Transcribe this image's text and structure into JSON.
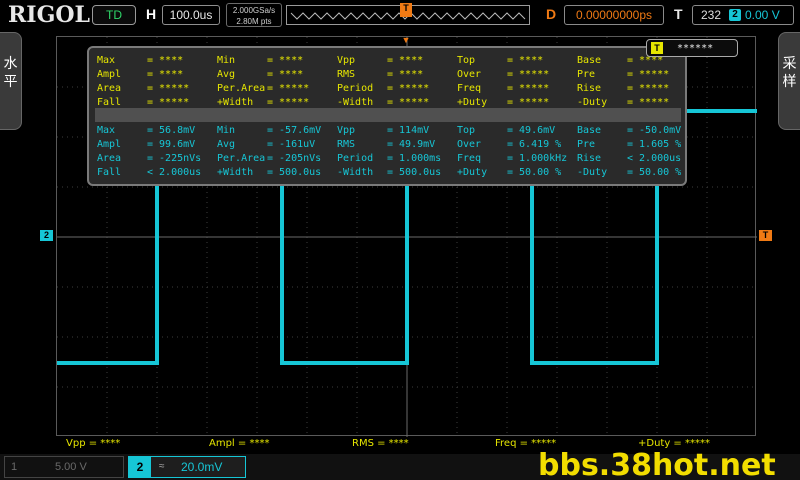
{
  "brand": "RIGOL",
  "topbar": {
    "mode": "TD",
    "h_label": "H",
    "timebase": "100.0us",
    "sample_rate": "2.000GSa/s",
    "memory_depth": "2.80M pts",
    "d_label": "D",
    "delay": "0.00000000ps",
    "t_label": "T",
    "trigger_count": "232",
    "trigger_source": "2",
    "trigger_level": "0.00 V"
  },
  "side": {
    "left_label": "水\n平",
    "right_label": "采\n样"
  },
  "markers": {
    "ch2": "2",
    "trigger_level": "T",
    "trigger_position": "T"
  },
  "measure": {
    "stats_label": "T",
    "stats_value": "******",
    "rows": [
      [
        "Max",
        "= ****",
        "Min",
        "= ****",
        "Vpp",
        "= ****",
        "Top",
        "= ****",
        "Base",
        "= ****"
      ],
      [
        "Ampl",
        "= ****",
        "Avg",
        "= ****",
        "RMS",
        "= ****",
        "Over",
        "= *****",
        "Pre",
        "= *****"
      ],
      [
        "Area",
        "= *****",
        "Per.Area",
        "= *****",
        "Period",
        "= *****",
        "Freq",
        "= *****",
        "Rise",
        "= *****"
      ],
      [
        "Fall",
        "= *****",
        "+Width",
        "= *****",
        "-Width",
        "= *****",
        "+Duty",
        "= *****",
        "-Duty",
        "= *****"
      ],
      [
        "Max",
        "= 56.8mV",
        "Min",
        "= -57.6mV",
        "Vpp",
        "= 114mV",
        "Top",
        "= 49.6mV",
        "Base",
        "= -50.0mV"
      ],
      [
        "Ampl",
        "= 99.6mV",
        "Avg",
        "= -161uV",
        "RMS",
        "= 49.9mV",
        "Over",
        "= 6.419 %",
        "Pre",
        "= 1.605 %"
      ],
      [
        "Area",
        "= -225nVs",
        "Per.Area",
        "= -205nVs",
        "Period",
        "= 1.000ms",
        "Freq",
        "= 1.000kHz",
        "Rise",
        "< 2.000us"
      ],
      [
        "Fall",
        "< 2.000us",
        "+Width",
        "= 500.0us",
        "-Width",
        "= 500.0us",
        "+Duty",
        "= 50.00 %",
        "-Duty",
        "= 50.00 %"
      ]
    ]
  },
  "bottom_measurements": [
    "Vpp = ****",
    "Ampl = ****",
    "RMS = ****",
    "Freq = *****",
    "+Duty = *****"
  ],
  "channels": {
    "ch1": {
      "number": "1",
      "scale": "5.00 V"
    },
    "ch2": {
      "number": "2",
      "coupling": "≈",
      "scale": "20.0mV"
    }
  },
  "watermark": "bbs.38hot.net",
  "waveform": {
    "channel": "2",
    "shape": "square",
    "period_divisions": 5,
    "duty": 0.5,
    "color": "#16c6d6"
  },
  "colors": {
    "ch2": "#16c6d6",
    "trigger": "#f07a14",
    "measure_header": "#e6e600",
    "mode": "#2fd86a"
  }
}
